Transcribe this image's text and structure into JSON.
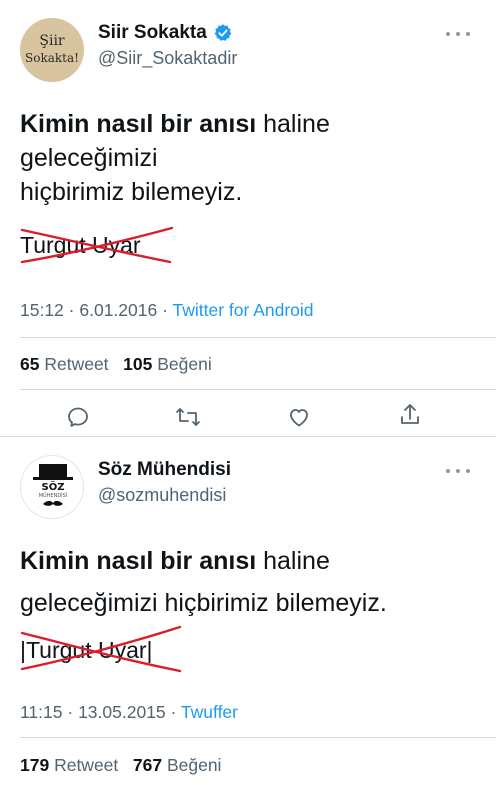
{
  "tweets": [
    {
      "name": "Siir Sokakta",
      "handle": "@Siir_Sokaktadir",
      "avatar_text_line1": "Şiir",
      "avatar_text_line2": "Sokakta!",
      "verified": true,
      "body": {
        "line1_bold": "Kimin nasıl bir anısı",
        "line1_rest": " haline",
        "line2": "geleceğimizi",
        "line3": "hiçbirimiz bilemeyiz."
      },
      "author": "Turgut Uyar",
      "time": "15:12",
      "date": "6.01.2016",
      "source": "Twitter for Android",
      "retweets": "65",
      "retweets_label": "Retweet",
      "likes": "105",
      "likes_label": "Beğeni"
    },
    {
      "name": "Söz Mühendisi",
      "handle": "@sozmuhendisi",
      "avatar_text_line1": "SÖZ",
      "avatar_text_line2": "MÜHENDİSİ",
      "verified": false,
      "body": {
        "line1_bold": "Kimin nasıl bir anısı",
        "line1_rest": " haline",
        "line2": "geleceğimizi hiçbirimiz bilemeyiz."
      },
      "author": "|Turgut Uyar|",
      "time": "11:15",
      "date": "13.05.2015",
      "source": "Twuffer",
      "retweets": "179",
      "retweets_label": "Retweet",
      "likes": "767",
      "likes_label": "Beğeni"
    }
  ],
  "colors": {
    "text": "#0f1419",
    "secondary": "#536471",
    "link": "#1d9bf0",
    "verified": "#1d9bf0",
    "strike": "#d81e2c",
    "divider": "#cfd9de"
  },
  "icons": [
    "more-icon",
    "verified-icon",
    "reply-icon",
    "retweet-icon",
    "like-icon",
    "share-icon"
  ]
}
